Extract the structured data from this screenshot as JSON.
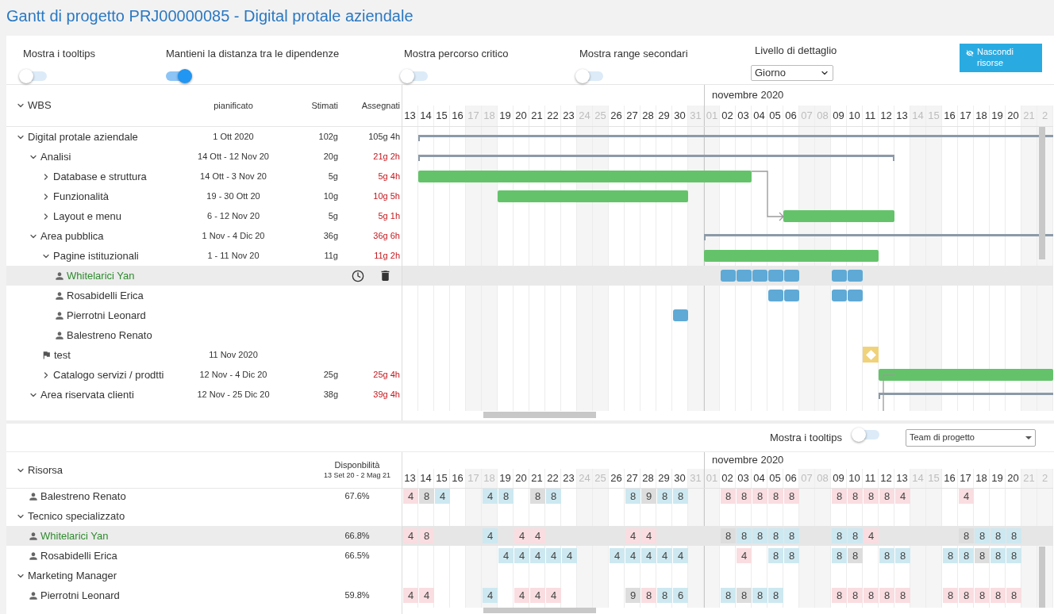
{
  "title": "Gantt di progetto PRJ00000085 - Digital protale aziendale",
  "toolbar": {
    "toggles": [
      {
        "label": "Mostra i tooltips",
        "on": false
      },
      {
        "label": "Mantieni la distanza tra le dipendenze",
        "on": true
      },
      {
        "label": "Mostra percorso critico",
        "on": false
      },
      {
        "label": "Mostra range secondari",
        "on": false
      }
    ],
    "detail_level": {
      "label": "Livello di dettaglio",
      "value": "Giorno"
    },
    "hide_button": {
      "label": "Nascondi risorse"
    }
  },
  "wbs": {
    "columns": {
      "name": "WBS",
      "planned": "pianificato",
      "estimated": "Stimati",
      "assigned": "Assegnati"
    },
    "days": [
      {
        "label": "13",
        "weekend": false
      },
      {
        "label": "14",
        "weekend": false
      },
      {
        "label": "15",
        "weekend": false
      },
      {
        "label": "16",
        "weekend": false
      },
      {
        "label": "17",
        "weekend": true
      },
      {
        "label": "18",
        "weekend": true
      },
      {
        "label": "19",
        "weekend": false
      },
      {
        "label": "20",
        "weekend": false
      },
      {
        "label": "21",
        "weekend": false
      },
      {
        "label": "22",
        "weekend": false
      },
      {
        "label": "23",
        "weekend": false
      },
      {
        "label": "24",
        "weekend": true
      },
      {
        "label": "25",
        "weekend": true
      },
      {
        "label": "26",
        "weekend": false
      },
      {
        "label": "27",
        "weekend": false
      },
      {
        "label": "28",
        "weekend": false
      },
      {
        "label": "29",
        "weekend": false
      },
      {
        "label": "30",
        "weekend": false
      },
      {
        "label": "31",
        "weekend": true
      },
      {
        "label": "01",
        "weekend": true,
        "month": "novembre 2020"
      },
      {
        "label": "02",
        "weekend": false
      },
      {
        "label": "03",
        "weekend": false
      },
      {
        "label": "04",
        "weekend": false
      },
      {
        "label": "05",
        "weekend": false
      },
      {
        "label": "06",
        "weekend": false
      },
      {
        "label": "07",
        "weekend": true
      },
      {
        "label": "08",
        "weekend": true
      },
      {
        "label": "09",
        "weekend": false
      },
      {
        "label": "10",
        "weekend": false
      },
      {
        "label": "11",
        "weekend": false
      },
      {
        "label": "12",
        "weekend": false
      },
      {
        "label": "13",
        "weekend": false
      },
      {
        "label": "14",
        "weekend": true
      },
      {
        "label": "15",
        "weekend": true
      },
      {
        "label": "16",
        "weekend": false
      },
      {
        "label": "17",
        "weekend": false
      },
      {
        "label": "18",
        "weekend": false
      },
      {
        "label": "19",
        "weekend": false
      },
      {
        "label": "20",
        "weekend": false
      },
      {
        "label": "21",
        "weekend": true
      },
      {
        "label": "2",
        "weekend": true
      }
    ],
    "items": [
      {
        "kind": "task",
        "name": "Digital protale aziendale",
        "planned": "1 Ott 2020",
        "estimated": "102g",
        "assigned": "105g 4h",
        "over": false,
        "expanded": true,
        "bar": {
          "kind": "summary",
          "days": [
            false,
            true,
            true,
            true,
            true,
            true,
            true,
            true,
            true,
            true,
            true,
            true,
            true,
            true,
            true,
            true,
            true,
            true,
            true,
            true,
            true,
            true,
            true,
            true,
            true,
            true,
            true,
            true,
            true,
            true,
            true,
            true,
            true,
            true,
            true,
            true,
            true,
            true,
            true,
            true,
            true
          ]
        },
        "children": [
          {
            "kind": "task",
            "name": "Analisi",
            "planned": "14 Ott - 12 Nov 20",
            "estimated": "20g",
            "assigned": "21g 2h",
            "over": true,
            "expanded": true,
            "bar": {
              "kind": "summary",
              "days": [
                false,
                true,
                true,
                true,
                true,
                true,
                true,
                true,
                true,
                true,
                true,
                true,
                true,
                true,
                true,
                true,
                true,
                true,
                true,
                true,
                true,
                true,
                true,
                true,
                true,
                true,
                true,
                true,
                true,
                true,
                true
              ]
            },
            "children": [
              {
                "kind": "task",
                "name": "Database e struttura",
                "planned": "14 Ott - 3 Nov 20",
                "estimated": "5g",
                "assigned": "5g 4h",
                "over": true,
                "expanded": false,
                "bar": {
                  "kind": "task",
                  "days": [
                    false,
                    true,
                    true,
                    true,
                    true,
                    true,
                    true,
                    true,
                    true,
                    true,
                    true,
                    true,
                    true,
                    true,
                    true,
                    true,
                    true,
                    true,
                    true,
                    true,
                    true,
                    true
                  ]
                }
              },
              {
                "kind": "task",
                "name": "Funzionalità",
                "planned": "19 - 30 Ott 20",
                "estimated": "10g",
                "assigned": "10g 5h",
                "over": true,
                "expanded": false,
                "bar": {
                  "kind": "task",
                  "days": [
                    false,
                    false,
                    false,
                    false,
                    false,
                    false,
                    true,
                    true,
                    true,
                    true,
                    true,
                    true,
                    true,
                    true,
                    true,
                    true,
                    true,
                    true
                  ]
                }
              },
              {
                "kind": "task",
                "name": "Layout e menu",
                "planned": "6 - 12 Nov 20",
                "estimated": "5g",
                "assigned": "5g 1h",
                "over": true,
                "expanded": false,
                "bar": {
                  "kind": "task",
                  "days": [
                    false,
                    false,
                    false,
                    false,
                    false,
                    false,
                    false,
                    false,
                    false,
                    false,
                    false,
                    false,
                    false,
                    false,
                    false,
                    false,
                    false,
                    false,
                    false,
                    false,
                    false,
                    false,
                    false,
                    false,
                    true,
                    true,
                    true,
                    true,
                    true,
                    true,
                    true
                  ]
                }
              }
            ]
          },
          {
            "kind": "task",
            "name": "Area pubblica",
            "planned": "1 Nov - 4 Dic 20",
            "estimated": "36g",
            "assigned": "36g 6h",
            "over": true,
            "expanded": true,
            "bar": {
              "kind": "summary",
              "days": [
                false,
                false,
                false,
                false,
                false,
                false,
                false,
                false,
                false,
                false,
                false,
                false,
                false,
                false,
                false,
                false,
                false,
                false,
                false,
                true,
                true,
                true,
                true,
                true,
                true,
                true,
                true,
                true,
                true,
                true,
                true,
                true,
                true,
                true,
                true,
                true,
                true,
                true,
                true,
                true,
                true
              ]
            },
            "children": [
              {
                "kind": "task",
                "name": "Pagine istituzionali",
                "planned": "1 - 11 Nov 20",
                "estimated": "11g",
                "assigned": "11g 2h",
                "over": true,
                "expanded": true,
                "bar": {
                  "kind": "task",
                  "days": [
                    false,
                    false,
                    false,
                    false,
                    false,
                    false,
                    false,
                    false,
                    false,
                    false,
                    false,
                    false,
                    false,
                    false,
                    false,
                    false,
                    false,
                    false,
                    false,
                    true,
                    true,
                    true,
                    true,
                    true,
                    true,
                    true,
                    true,
                    true,
                    true,
                    true
                  ]
                },
                "children": [
                  {
                    "kind": "resource",
                    "name": "Whitelarici Yan",
                    "selected": true,
                    "bar": {
                      "kind": "assignment",
                      "days": [
                        false,
                        false,
                        false,
                        false,
                        false,
                        false,
                        false,
                        false,
                        false,
                        false,
                        false,
                        false,
                        false,
                        false,
                        false,
                        false,
                        false,
                        false,
                        false,
                        false,
                        true,
                        true,
                        true,
                        true,
                        true,
                        false,
                        false,
                        true,
                        true
                      ]
                    }
                  },
                  {
                    "kind": "resource",
                    "name": "Rosabidelli Erica",
                    "selected": false,
                    "bar": {
                      "kind": "assignment",
                      "days": [
                        false,
                        false,
                        false,
                        false,
                        false,
                        false,
                        false,
                        false,
                        false,
                        false,
                        false,
                        false,
                        false,
                        false,
                        false,
                        false,
                        false,
                        false,
                        false,
                        false,
                        false,
                        false,
                        false,
                        true,
                        true,
                        false,
                        false,
                        true,
                        true
                      ]
                    }
                  },
                  {
                    "kind": "resource",
                    "name": "Pierrotni Leonard",
                    "selected": false,
                    "bar": {
                      "kind": "assignment",
                      "days": [
                        false,
                        false,
                        false,
                        false,
                        false,
                        false,
                        false,
                        false,
                        false,
                        false,
                        false,
                        false,
                        false,
                        false,
                        false,
                        false,
                        false,
                        true
                      ]
                    }
                  },
                  {
                    "kind": "resource",
                    "name": "Balestreno Renato",
                    "selected": false
                  }
                ]
              },
              {
                "kind": "milestone",
                "name": "test",
                "planned": "11 Nov 2020",
                "bar": {
                  "kind": "milestone",
                  "days": [
                    false,
                    false,
                    false,
                    false,
                    false,
                    false,
                    false,
                    false,
                    false,
                    false,
                    false,
                    false,
                    false,
                    false,
                    false,
                    false,
                    false,
                    false,
                    false,
                    false,
                    false,
                    false,
                    false,
                    false,
                    false,
                    false,
                    false,
                    false,
                    false,
                    true
                  ]
                }
              },
              {
                "kind": "task",
                "name": "Catalogo servizi / prodtti",
                "planned": "12 Nov - 4 Dic 20",
                "estimated": "25g",
                "assigned": "25g 4h",
                "over": true,
                "expanded": false,
                "bar": {
                  "kind": "task",
                  "days": [
                    false,
                    false,
                    false,
                    false,
                    false,
                    false,
                    false,
                    false,
                    false,
                    false,
                    false,
                    false,
                    false,
                    false,
                    false,
                    false,
                    false,
                    false,
                    false,
                    false,
                    false,
                    false,
                    false,
                    false,
                    false,
                    false,
                    false,
                    false,
                    false,
                    false,
                    true,
                    true,
                    true,
                    true,
                    true,
                    true,
                    true,
                    true,
                    true,
                    true,
                    true
                  ]
                }
              }
            ]
          },
          {
            "kind": "task",
            "name": "Area riservata clienti",
            "planned": "12 Nov - 25 Dic 20",
            "estimated": "38g",
            "assigned": "39g 4h",
            "over": true,
            "expanded": true,
            "bar": {
              "kind": "summary",
              "days": [
                false,
                false,
                false,
                false,
                false,
                false,
                false,
                false,
                false,
                false,
                false,
                false,
                false,
                false,
                false,
                false,
                false,
                false,
                false,
                false,
                false,
                false,
                false,
                false,
                false,
                false,
                false,
                false,
                false,
                false,
                true,
                true,
                true,
                true,
                true,
                true,
                true,
                true,
                true,
                true,
                true
              ]
            }
          }
        ]
      }
    ]
  },
  "resource_panel": {
    "tooltip_toggle": {
      "label": "Mostra i tooltips",
      "on": false
    },
    "team_select": {
      "value": "Team di progetto"
    },
    "columns": {
      "resource": "Risorsa",
      "availability": "Disponbilità",
      "availability_range": "13 Set 20 - 2 Mag 21"
    },
    "days": [
      {
        "label": "13",
        "weekend": false
      },
      {
        "label": "14",
        "weekend": false
      },
      {
        "label": "15",
        "weekend": false
      },
      {
        "label": "16",
        "weekend": false
      },
      {
        "label": "17",
        "weekend": true
      },
      {
        "label": "18",
        "weekend": true
      },
      {
        "label": "19",
        "weekend": false
      },
      {
        "label": "20",
        "weekend": false
      },
      {
        "label": "21",
        "weekend": false
      },
      {
        "label": "22",
        "weekend": false
      },
      {
        "label": "23",
        "weekend": false
      },
      {
        "label": "24",
        "weekend": true
      },
      {
        "label": "25",
        "weekend": true
      },
      {
        "label": "26",
        "weekend": false
      },
      {
        "label": "27",
        "weekend": false
      },
      {
        "label": "28",
        "weekend": false
      },
      {
        "label": "29",
        "weekend": false
      },
      {
        "label": "30",
        "weekend": false
      },
      {
        "label": "31",
        "weekend": true
      },
      {
        "label": "01",
        "weekend": true,
        "month": "novembre 2020"
      },
      {
        "label": "02",
        "weekend": false
      },
      {
        "label": "03",
        "weekend": false
      },
      {
        "label": "04",
        "weekend": false
      },
      {
        "label": "05",
        "weekend": false
      },
      {
        "label": "06",
        "weekend": false
      },
      {
        "label": "07",
        "weekend": true
      },
      {
        "label": "08",
        "weekend": true
      },
      {
        "label": "09",
        "weekend": false
      },
      {
        "label": "10",
        "weekend": false
      },
      {
        "label": "11",
        "weekend": false
      },
      {
        "label": "12",
        "weekend": false
      },
      {
        "label": "13",
        "weekend": false
      },
      {
        "label": "14",
        "weekend": true
      },
      {
        "label": "15",
        "weekend": true
      },
      {
        "label": "16",
        "weekend": false
      },
      {
        "label": "17",
        "weekend": false
      },
      {
        "label": "18",
        "weekend": false
      },
      {
        "label": "19",
        "weekend": false
      },
      {
        "label": "20",
        "weekend": false
      },
      {
        "label": "21",
        "weekend": true
      },
      {
        "label": "2",
        "weekend": true
      }
    ],
    "resources": [
      {
        "kind": "person",
        "name": "Balestreno Renato",
        "availability": "67.6%",
        "selected": false,
        "hours": [
          {
            "kind": "hours",
            "text": "4",
            "color": "#f9dde0"
          },
          {
            "kind": "hours",
            "text": "8",
            "color": "#dddddd"
          },
          {
            "kind": "hours",
            "text": "4",
            "color": "#cde8f0"
          },
          {
            "kind": "blank"
          },
          {
            "kind": "blank"
          },
          {
            "kind": "hours",
            "text": "4",
            "color": "#cde8f0"
          },
          {
            "kind": "hours",
            "text": "8",
            "color": "#cde8f0"
          },
          {
            "kind": "blank"
          },
          {
            "kind": "hours",
            "text": "8",
            "color": "#dddddd"
          },
          {
            "kind": "hours",
            "text": "8",
            "color": "#cde8f0"
          },
          {
            "kind": "blank"
          },
          {
            "kind": "blank"
          },
          {
            "kind": "blank"
          },
          {
            "kind": "blank"
          },
          {
            "kind": "hours",
            "text": "8",
            "color": "#cde8f0"
          },
          {
            "kind": "hours",
            "text": "9",
            "color": "#dddddd"
          },
          {
            "kind": "hours",
            "text": "8",
            "color": "#cde8f0"
          },
          {
            "kind": "hours",
            "text": "8",
            "color": "#cde8f0"
          },
          {
            "kind": "blank"
          },
          {
            "kind": "blank"
          },
          {
            "kind": "hours",
            "text": "8",
            "color": "#f9dde0"
          },
          {
            "kind": "hours",
            "text": "8",
            "color": "#f9dde0"
          },
          {
            "kind": "hours",
            "text": "8",
            "color": "#f9dde0"
          },
          {
            "kind": "hours",
            "text": "8",
            "color": "#f9dde0"
          },
          {
            "kind": "hours",
            "text": "8",
            "color": "#f9dde0"
          },
          {
            "kind": "blank"
          },
          {
            "kind": "blank"
          },
          {
            "kind": "hours",
            "text": "8",
            "color": "#f9dde0"
          },
          {
            "kind": "hours",
            "text": "8",
            "color": "#f9dde0"
          },
          {
            "kind": "hours",
            "text": "8",
            "color": "#f9dde0"
          },
          {
            "kind": "hours",
            "text": "8",
            "color": "#f9dde0"
          },
          {
            "kind": "hours",
            "text": "4",
            "color": "#f9dde0"
          },
          {
            "kind": "blank"
          },
          {
            "kind": "blank"
          },
          {
            "kind": "blank"
          },
          {
            "kind": "hours",
            "text": "4",
            "color": "#f9dde0"
          }
        ]
      },
      {
        "kind": "group",
        "name": "Tecnico specializzato",
        "expanded": true,
        "children": [
          {
            "kind": "person",
            "name": "Whitelarici Yan",
            "availability": "66.8%",
            "selected": true,
            "hours": [
              {
                "kind": "hours",
                "text": "4",
                "color": "#f9dde0"
              },
              {
                "kind": "hours",
                "text": "8",
                "color": "#f9dde0"
              },
              {
                "kind": "blank"
              },
              {
                "kind": "blank"
              },
              {
                "kind": "blank"
              },
              {
                "kind": "hours",
                "text": "4",
                "color": "#cde8f0"
              },
              {
                "kind": "blank"
              },
              {
                "kind": "hours",
                "text": "4",
                "color": "#f9dde0"
              },
              {
                "kind": "hours",
                "text": "4",
                "color": "#f9dde0"
              },
              {
                "kind": "blank"
              },
              {
                "kind": "blank"
              },
              {
                "kind": "blank"
              },
              {
                "kind": "blank"
              },
              {
                "kind": "blank"
              },
              {
                "kind": "hours",
                "text": "4",
                "color": "#f9dde0"
              },
              {
                "kind": "hours",
                "text": "4",
                "color": "#f9dde0"
              },
              {
                "kind": "blank"
              },
              {
                "kind": "blank"
              },
              {
                "kind": "blank"
              },
              {
                "kind": "blank"
              },
              {
                "kind": "hours",
                "text": "8",
                "color": "#dddddd"
              },
              {
                "kind": "hours",
                "text": "8",
                "color": "#cde8f0"
              },
              {
                "kind": "hours",
                "text": "8",
                "color": "#cde8f0"
              },
              {
                "kind": "hours",
                "text": "8",
                "color": "#cde8f0"
              },
              {
                "kind": "hours",
                "text": "8",
                "color": "#cde8f0"
              },
              {
                "kind": "blank"
              },
              {
                "kind": "blank"
              },
              {
                "kind": "hours",
                "text": "8",
                "color": "#cde8f0"
              },
              {
                "kind": "hours",
                "text": "8",
                "color": "#cde8f0"
              },
              {
                "kind": "hours",
                "text": "4",
                "color": "#f9dde0"
              },
              {
                "kind": "blank"
              },
              {
                "kind": "blank"
              },
              {
                "kind": "blank"
              },
              {
                "kind": "blank"
              },
              {
                "kind": "blank"
              },
              {
                "kind": "hours",
                "text": "8",
                "color": "#dddddd"
              },
              {
                "kind": "hours",
                "text": "8",
                "color": "#cde8f0"
              },
              {
                "kind": "hours",
                "text": "8",
                "color": "#cde8f0"
              },
              {
                "kind": "hours",
                "text": "8",
                "color": "#cde8f0"
              }
            ]
          },
          {
            "kind": "person",
            "name": "Rosabidelli Erica",
            "availability": "66.5%",
            "selected": false,
            "hours": [
              {
                "kind": "blank"
              },
              {
                "kind": "blank"
              },
              {
                "kind": "blank"
              },
              {
                "kind": "blank"
              },
              {
                "kind": "blank"
              },
              {
                "kind": "blank"
              },
              {
                "kind": "hours",
                "text": "4",
                "color": "#cde8f0"
              },
              {
                "kind": "hours",
                "text": "4",
                "color": "#cde8f0"
              },
              {
                "kind": "hours",
                "text": "4",
                "color": "#cde8f0"
              },
              {
                "kind": "hours",
                "text": "4",
                "color": "#cde8f0"
              },
              {
                "kind": "hours",
                "text": "4",
                "color": "#cde8f0"
              },
              {
                "kind": "blank"
              },
              {
                "kind": "blank"
              },
              {
                "kind": "hours",
                "text": "4",
                "color": "#cde8f0"
              },
              {
                "kind": "hours",
                "text": "4",
                "color": "#cde8f0"
              },
              {
                "kind": "hours",
                "text": "4",
                "color": "#cde8f0"
              },
              {
                "kind": "hours",
                "text": "4",
                "color": "#cde8f0"
              },
              {
                "kind": "hours",
                "text": "4",
                "color": "#cde8f0"
              },
              {
                "kind": "blank"
              },
              {
                "kind": "blank"
              },
              {
                "kind": "blank"
              },
              {
                "kind": "hours",
                "text": "4",
                "color": "#f9dde0"
              },
              {
                "kind": "blank"
              },
              {
                "kind": "hours",
                "text": "8",
                "color": "#cde8f0"
              },
              {
                "kind": "hours",
                "text": "8",
                "color": "#cde8f0"
              },
              {
                "kind": "blank"
              },
              {
                "kind": "blank"
              },
              {
                "kind": "hours",
                "text": "8",
                "color": "#cde8f0"
              },
              {
                "kind": "hours",
                "text": "8",
                "color": "#dddddd"
              },
              {
                "kind": "blank"
              },
              {
                "kind": "hours",
                "text": "8",
                "color": "#cde8f0"
              },
              {
                "kind": "hours",
                "text": "8",
                "color": "#cde8f0"
              },
              {
                "kind": "blank"
              },
              {
                "kind": "blank"
              },
              {
                "kind": "hours",
                "text": "8",
                "color": "#cde8f0"
              },
              {
                "kind": "hours",
                "text": "8",
                "color": "#cde8f0"
              },
              {
                "kind": "hours",
                "text": "8",
                "color": "#dddddd"
              },
              {
                "kind": "hours",
                "text": "8",
                "color": "#cde8f0"
              },
              {
                "kind": "hours",
                "text": "8",
                "color": "#cde8f0"
              }
            ]
          }
        ]
      },
      {
        "kind": "group",
        "name": "Marketing Manager",
        "expanded": true,
        "children": [
          {
            "kind": "person",
            "name": "Pierrotni Leonard",
            "availability": "59.8%",
            "selected": false,
            "hours": [
              {
                "kind": "hours",
                "text": "4",
                "color": "#f9dde0"
              },
              {
                "kind": "hours",
                "text": "4",
                "color": "#f9dde0"
              },
              {
                "kind": "blank"
              },
              {
                "kind": "blank"
              },
              {
                "kind": "blank"
              },
              {
                "kind": "hours",
                "text": "4",
                "color": "#cde8f0"
              },
              {
                "kind": "blank"
              },
              {
                "kind": "hours",
                "text": "4",
                "color": "#f9dde0"
              },
              {
                "kind": "hours",
                "text": "4",
                "color": "#f9dde0"
              },
              {
                "kind": "hours",
                "text": "4",
                "color": "#f9dde0"
              },
              {
                "kind": "blank"
              },
              {
                "kind": "blank"
              },
              {
                "kind": "blank"
              },
              {
                "kind": "blank"
              },
              {
                "kind": "hours",
                "text": "9",
                "color": "#dddddd"
              },
              {
                "kind": "hours",
                "text": "8",
                "color": "#f9dde0"
              },
              {
                "kind": "hours",
                "text": "8",
                "color": "#cde8f0"
              },
              {
                "kind": "hours",
                "text": "6",
                "color": "#cde8f0"
              },
              {
                "kind": "blank"
              },
              {
                "kind": "blank"
              },
              {
                "kind": "hours",
                "text": "8",
                "color": "#cde8f0"
              },
              {
                "kind": "hours",
                "text": "8",
                "color": "#dddddd"
              },
              {
                "kind": "hours",
                "text": "8",
                "color": "#cde8f0"
              },
              {
                "kind": "hours",
                "text": "8",
                "color": "#cde8f0"
              },
              {
                "kind": "blank"
              },
              {
                "kind": "blank"
              },
              {
                "kind": "blank"
              },
              {
                "kind": "hours",
                "text": "8",
                "color": "#f9dde0"
              },
              {
                "kind": "hours",
                "text": "8",
                "color": "#f9dde0"
              },
              {
                "kind": "hours",
                "text": "8",
                "color": "#f9dde0"
              },
              {
                "kind": "hours",
                "text": "8",
                "color": "#f9dde0"
              },
              {
                "kind": "hours",
                "text": "8",
                "color": "#f9dde0"
              },
              {
                "kind": "blank"
              },
              {
                "kind": "blank"
              },
              {
                "kind": "hours",
                "text": "8",
                "color": "#f9dde0"
              },
              {
                "kind": "hours",
                "text": "8",
                "color": "#f9dde0"
              },
              {
                "kind": "hours",
                "text": "8",
                "color": "#f9dde0"
              },
              {
                "kind": "hours",
                "text": "8",
                "color": "#f9dde0"
              },
              {
                "kind": "hours",
                "text": "8",
                "color": "#f9dde0"
              }
            ]
          }
        ]
      }
    ]
  }
}
